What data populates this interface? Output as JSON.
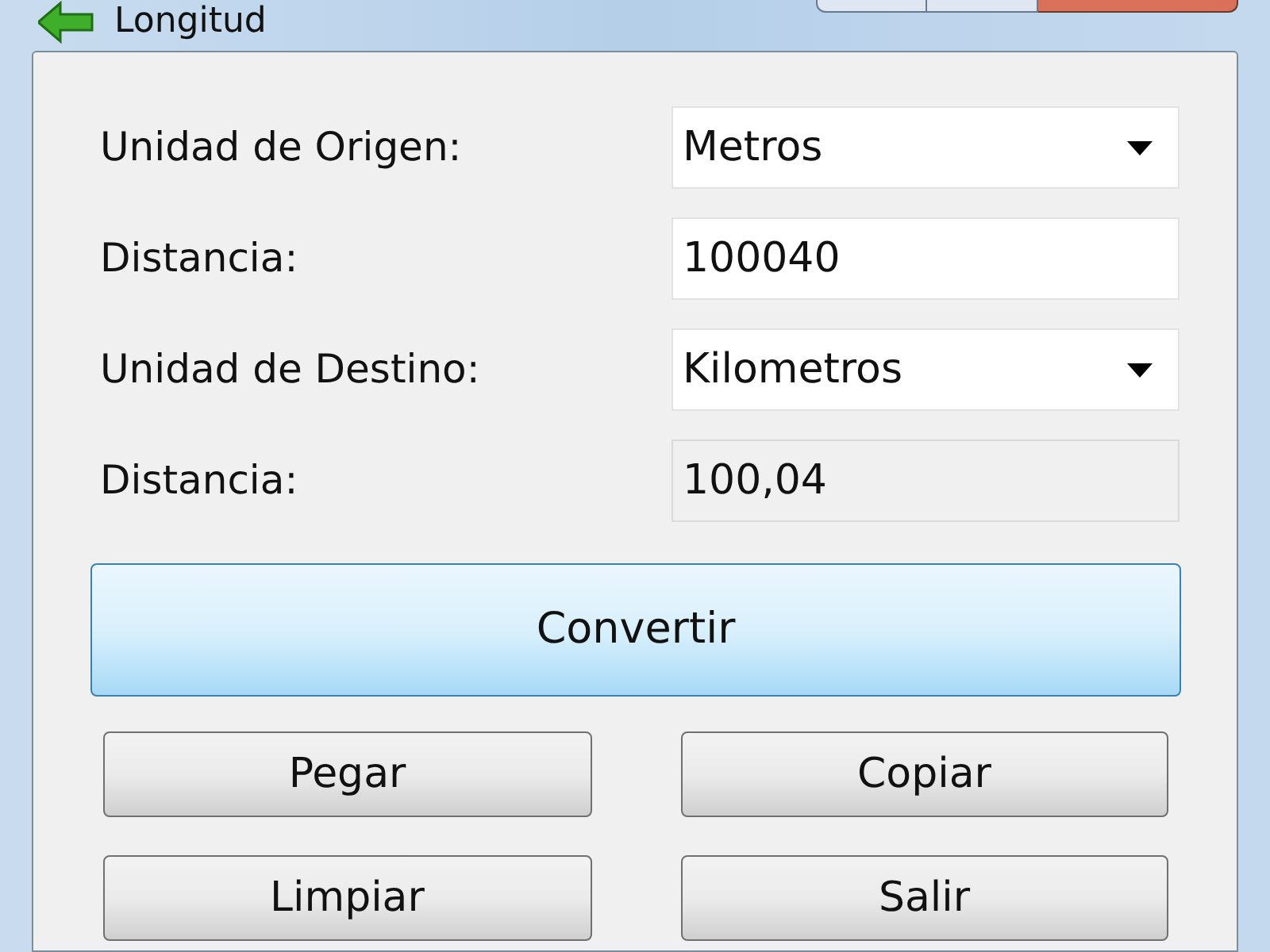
{
  "window": {
    "title": "Longitud"
  },
  "fields": [
    {
      "label": "Unidad de Origen:",
      "kind": "combo",
      "value": "Metros"
    },
    {
      "label": "Distancia:",
      "kind": "text",
      "value": "100040"
    },
    {
      "label": "Unidad de Destino:",
      "kind": "combo",
      "value": "Kilometros"
    },
    {
      "label": "Distancia:",
      "kind": "readonly",
      "value": "100,04"
    }
  ],
  "primary_button": "Convertir",
  "buttons": [
    "Pegar",
    "Copiar",
    "Limpiar",
    "Salir"
  ]
}
